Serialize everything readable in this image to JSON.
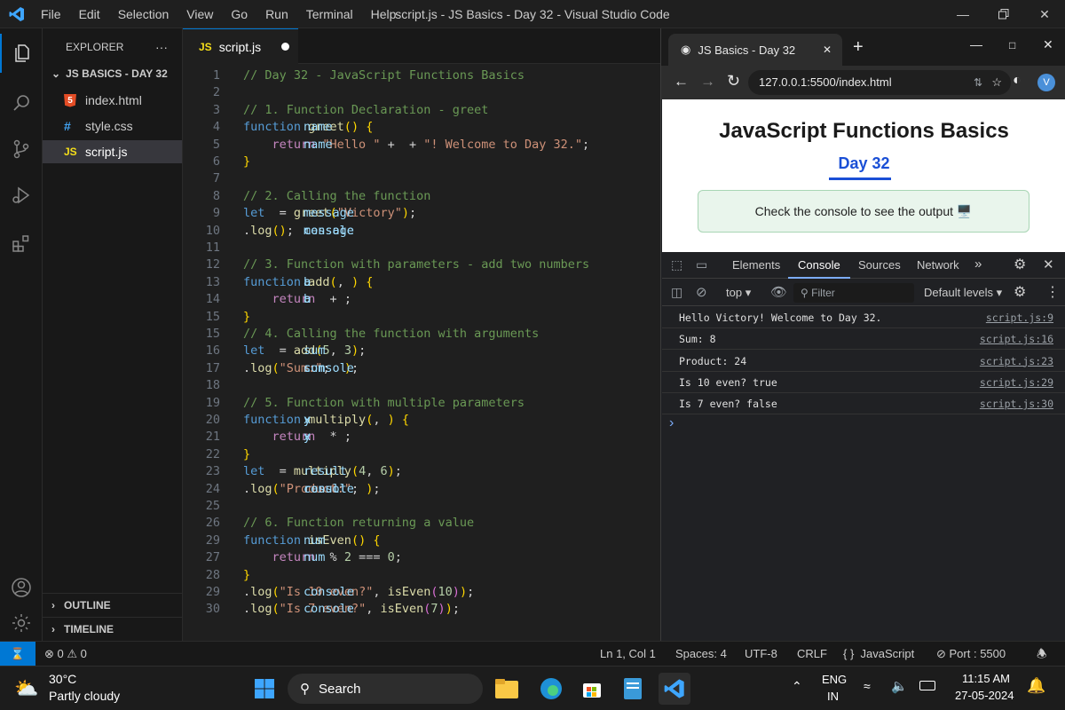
{
  "window": {
    "title": "script.js - JS Basics - Day 32 - Visual Studio Code",
    "menu": [
      "File",
      "Edit",
      "Selection",
      "View",
      "Go",
      "Run",
      "Terminal",
      "Help"
    ]
  },
  "sidebar": {
    "header": "EXPLORER",
    "more": "···",
    "folder": "JS BASICS - DAY 32",
    "files": [
      {
        "name": "index.html",
        "icon": "html-file-icon"
      },
      {
        "name": "style.css",
        "icon": "css-file-icon"
      },
      {
        "name": "script.js",
        "icon": "js-file-icon"
      }
    ],
    "outline": "OUTLINE",
    "timeline": "TIMELINE"
  },
  "editor": {
    "tab_label": "script.js",
    "tab_icon": "JS",
    "code": [
      {
        "n": "1",
        "t": [
          [
            "cm",
            "// Day 32 - JavaScript Functions Basics"
          ]
        ]
      },
      {
        "n": "2",
        "t": []
      },
      {
        "n": "3",
        "t": [
          [
            "cm",
            "// 1. Function Declaration - greet"
          ]
        ]
      },
      {
        "n": "4",
        "t": [
          [
            "kw",
            "function "
          ],
          [
            "fn",
            "greet"
          ],
          [
            "br",
            "("
          ],
          [
            "tx",
            "name"
          ],
          [
            "br",
            ")"
          ],
          [
            "pl",
            " "
          ],
          [
            "br",
            "{"
          ]
        ]
      },
      {
        "n": "5",
        "t": [
          [
            "pl",
            "    "
          ],
          [
            "ctl",
            "return "
          ],
          [
            "st",
            "\"Hello \""
          ],
          [
            "op",
            " + "
          ],
          [
            "tx",
            "name"
          ],
          [
            "op",
            " + "
          ],
          [
            "st",
            "\"! Welcome to Day 32.\""
          ],
          [
            "pl",
            ";"
          ]
        ]
      },
      {
        "n": "6",
        "t": [
          [
            "br",
            "}"
          ]
        ]
      },
      {
        "n": "7",
        "t": []
      },
      {
        "n": "8",
        "t": [
          [
            "cm",
            "// 2. Calling the function"
          ]
        ]
      },
      {
        "n": "9",
        "t": [
          [
            "kw",
            "let "
          ],
          [
            "tx",
            "message"
          ],
          [
            "op",
            " = "
          ],
          [
            "fn",
            "greet"
          ],
          [
            "br",
            "("
          ],
          [
            "st",
            "\"Victory\""
          ],
          [
            "br",
            ")"
          ],
          [
            "pl",
            ";"
          ]
        ]
      },
      {
        "n": "10",
        "t": [
          [
            "tx",
            "console"
          ],
          [
            "pl",
            "."
          ],
          [
            "fn",
            "log"
          ],
          [
            "br",
            "("
          ],
          [
            "tx",
            "message"
          ],
          [
            "br",
            ")"
          ],
          [
            "pl",
            ";"
          ]
        ]
      },
      {
        "n": "11",
        "t": []
      },
      {
        "n": "12",
        "t": [
          [
            "cm",
            "// 3. Function with parameters - add two numbers"
          ]
        ]
      },
      {
        "n": "13",
        "t": [
          [
            "kw",
            "function "
          ],
          [
            "fn",
            "add"
          ],
          [
            "br",
            "("
          ],
          [
            "tx",
            "a"
          ],
          [
            "pl",
            ", "
          ],
          [
            "tx",
            "b"
          ],
          [
            "br",
            ")"
          ],
          [
            "pl",
            " "
          ],
          [
            "br",
            "{"
          ]
        ]
      },
      {
        "n": "14",
        "t": [
          [
            "pl",
            "    "
          ],
          [
            "ctl",
            "return "
          ],
          [
            "tx",
            "a"
          ],
          [
            "op",
            " + "
          ],
          [
            "tx",
            "b"
          ],
          [
            "pl",
            ";"
          ]
        ]
      },
      {
        "n": "15",
        "t": [
          [
            "br",
            "}"
          ]
        ]
      },
      {
        "n": "15",
        "t": [
          [
            "cm",
            "// 4. Calling the function with arguments"
          ]
        ]
      },
      {
        "n": "16",
        "t": [
          [
            "kw",
            "let "
          ],
          [
            "tx",
            "sum"
          ],
          [
            "op",
            " = "
          ],
          [
            "fn",
            "add"
          ],
          [
            "br",
            "("
          ],
          [
            "nm",
            "5"
          ],
          [
            "pl",
            ", "
          ],
          [
            "nm",
            "3"
          ],
          [
            "br",
            ")"
          ],
          [
            "pl",
            ";"
          ]
        ]
      },
      {
        "n": "17",
        "t": [
          [
            "tx",
            "console"
          ],
          [
            "pl",
            "."
          ],
          [
            "fn",
            "log"
          ],
          [
            "br",
            "("
          ],
          [
            "st",
            "\"Sum:\""
          ],
          [
            "pl",
            ";  "
          ],
          [
            "tx",
            "sum"
          ],
          [
            "br",
            ")"
          ],
          [
            "pl",
            ";"
          ]
        ]
      },
      {
        "n": "18",
        "t": []
      },
      {
        "n": "19",
        "t": [
          [
            "cm",
            "// 5. Function with multiple parameters"
          ]
        ]
      },
      {
        "n": "20",
        "t": [
          [
            "kw",
            "function "
          ],
          [
            "fn",
            "multiply"
          ],
          [
            "br",
            "("
          ],
          [
            "tx",
            "x"
          ],
          [
            "pl",
            ", "
          ],
          [
            "tx",
            "y"
          ],
          [
            "br",
            ")"
          ],
          [
            "pl",
            " "
          ],
          [
            "br",
            "{"
          ]
        ]
      },
      {
        "n": "21",
        "t": [
          [
            "pl",
            "    "
          ],
          [
            "ctl",
            "return "
          ],
          [
            "tx",
            "x"
          ],
          [
            "op",
            " * "
          ],
          [
            "tx",
            "y"
          ],
          [
            "pl",
            ";"
          ]
        ]
      },
      {
        "n": "22",
        "t": [
          [
            "br",
            "}"
          ]
        ]
      },
      {
        "n": "23",
        "t": [
          [
            "kw",
            "let "
          ],
          [
            "tx",
            "result"
          ],
          [
            "op",
            " = "
          ],
          [
            "fn",
            "multiply"
          ],
          [
            "br",
            "("
          ],
          [
            "nm",
            "4"
          ],
          [
            "pl",
            ", "
          ],
          [
            "nm",
            "6"
          ],
          [
            "br",
            ")"
          ],
          [
            "pl",
            ";"
          ]
        ]
      },
      {
        "n": "24",
        "t": [
          [
            "tx",
            "console"
          ],
          [
            "pl",
            "."
          ],
          [
            "fn",
            "log"
          ],
          [
            "br",
            "("
          ],
          [
            "st",
            "\"Product:\""
          ],
          [
            "pl",
            "; "
          ],
          [
            "tx",
            "result"
          ],
          [
            "br",
            ")"
          ],
          [
            "pl",
            ";"
          ]
        ]
      },
      {
        "n": "25",
        "t": []
      },
      {
        "n": "26",
        "t": [
          [
            "cm",
            "// 6. Function returning a value"
          ]
        ]
      },
      {
        "n": "29",
        "t": [
          [
            "kw",
            "function "
          ],
          [
            "fn",
            "isEven"
          ],
          [
            "br",
            "("
          ],
          [
            "tx",
            "num"
          ],
          [
            "br",
            ")"
          ],
          [
            "pl",
            " "
          ],
          [
            "br",
            "{"
          ]
        ]
      },
      {
        "n": "27",
        "t": [
          [
            "pl",
            "    "
          ],
          [
            "ctl",
            "return "
          ],
          [
            "tx",
            "num"
          ],
          [
            "op",
            " % "
          ],
          [
            "nm",
            "2"
          ],
          [
            "op",
            " === "
          ],
          [
            "nm",
            "0"
          ],
          [
            "pl",
            ";"
          ]
        ]
      },
      {
        "n": "28",
        "t": [
          [
            "br",
            "}"
          ]
        ]
      },
      {
        "n": "29",
        "t": [
          [
            "tx",
            "console"
          ],
          [
            "pl",
            "."
          ],
          [
            "fn",
            "log"
          ],
          [
            "br",
            "("
          ],
          [
            "st",
            "\"Is 10 even?\""
          ],
          [
            "pl",
            ", "
          ],
          [
            "fn",
            "isEven"
          ],
          [
            "br2",
            "("
          ],
          [
            "nm",
            "10"
          ],
          [
            "br2",
            ")"
          ],
          [
            "br",
            ")"
          ],
          [
            "pl",
            ";"
          ]
        ]
      },
      {
        "n": "30",
        "t": [
          [
            "tx",
            "console"
          ],
          [
            "pl",
            "."
          ],
          [
            "fn",
            "log"
          ],
          [
            "br",
            "("
          ],
          [
            "st",
            "\"Is 7 even?\""
          ],
          [
            "pl",
            ", "
          ],
          [
            "fn",
            "isEven"
          ],
          [
            "br2",
            "("
          ],
          [
            "nm",
            "7"
          ],
          [
            "br2",
            ")"
          ],
          [
            "br",
            ")"
          ],
          [
            "pl",
            ";"
          ]
        ]
      }
    ]
  },
  "browser": {
    "tab_title": "JS Basics - Day 32",
    "new_tab": "+",
    "url": "127.0.0.1:5500/index.html",
    "profile": "V",
    "page": {
      "heading": "JavaScript Functions Basics",
      "subheading": "Day 32",
      "notice": "Check the console to see the output 🖥️"
    },
    "devtools": {
      "tabs": [
        "Elements",
        "Console",
        "Sources",
        "Network"
      ],
      "active_tab": "Console",
      "more": "»",
      "context": "top",
      "filter_placeholder": "Filter",
      "levels": "Default levels",
      "console": [
        {
          "msg": "Hello Victory! Welcome to Day 32.",
          "src": "script.js:9"
        },
        {
          "msg": "Sum: 8",
          "src": "script.js:16"
        },
        {
          "msg": "Product: 24",
          "src": "script.js:23"
        },
        {
          "msg": "Is 10 even? true",
          "src": "script.js:29"
        },
        {
          "msg": "Is 7 even? false",
          "src": "script.js:30"
        }
      ],
      "prompt": "›"
    }
  },
  "statusbar": {
    "errors": "0",
    "warnings": "0",
    "position": "Ln 1, Col 1",
    "spaces": "Spaces: 4",
    "encoding": "UTF-8",
    "eol": "CRLF",
    "language": "JavaScript",
    "language_glyph": "{ }",
    "port": "Port : 5500"
  },
  "taskbar": {
    "weather_temp": "30°C",
    "weather_desc": "Partly cloudy",
    "search": "Search",
    "lang_top": "ENG",
    "lang_bottom": "IN",
    "time": "11:15 AM",
    "date": "27-05-2024"
  },
  "colors": {
    "accent": "#0078d4",
    "editor_bg": "#1f1f1f",
    "sidebar_bg": "#181818"
  }
}
